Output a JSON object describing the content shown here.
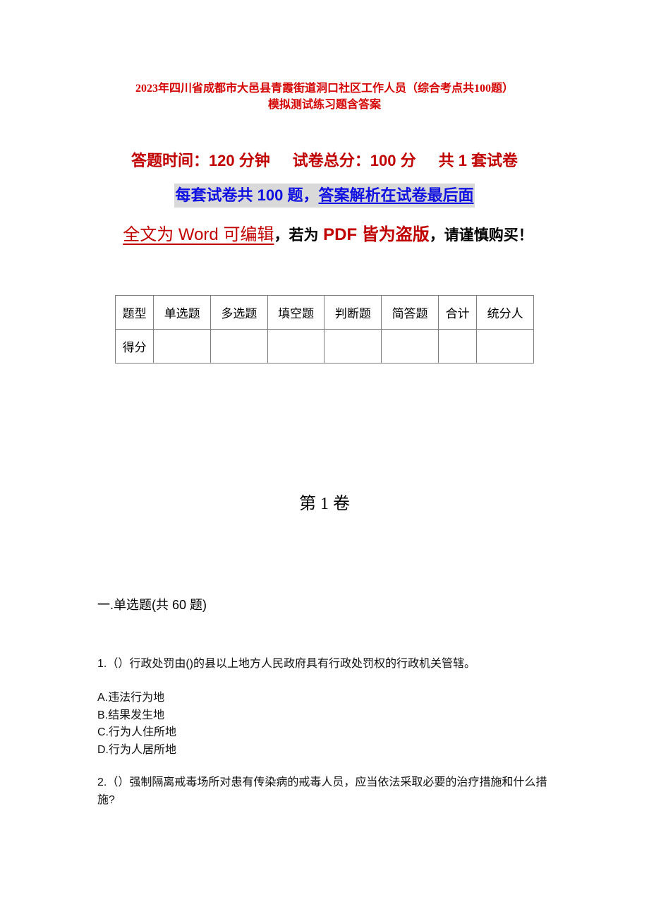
{
  "document": {
    "title_line1": "2023年四川省成都市大邑县青霞街道洞口社区工作人员（综合考点共100题）",
    "title_line2": "模拟测试练习题含答案",
    "exam_time": "答题时间：120 分钟",
    "total_score": "试卷总分：100 分",
    "set_count": "共 1 套试卷",
    "blue_note_part1": "每套试卷共 100 题，",
    "blue_note_part2": "答案解析在试卷最后面",
    "warn_part1": "全文为 Word 可编辑",
    "warn_comma1": "，",
    "warn_part2": "若为",
    "warn_part3": " PDF 皆为盗版",
    "warn_comma2": "，",
    "warn_part4": "请谨慎购买！",
    "colors": {
      "title_red": "#d40000",
      "info_red": "#c00000",
      "blue": "#1010e0",
      "highlight_gray": "#d9d9d9"
    }
  },
  "score_table": {
    "header": [
      "题型",
      "单选题",
      "多选题",
      "填空题",
      "判断题",
      "简答题",
      "合计",
      "统分人"
    ],
    "row": [
      "得分",
      "",
      "",
      "",
      "",
      "",
      "",
      ""
    ]
  },
  "volume_title": "第 1 卷",
  "section_title": "一.单选题(共 60 题)",
  "questions": [
    {
      "text": "1.（）行政处罚由()的县以上地方人民政府具有行政处罚权的行政机关管辖。",
      "options": [
        "A.违法行为地",
        "B.结果发生地",
        "C.行为人住所地",
        "D.行为人居所地"
      ]
    },
    {
      "text": "2.（）强制隔离戒毒场所对患有传染病的戒毒人员，应当依法采取必要的治疗措施和什么措施?",
      "options": []
    }
  ]
}
